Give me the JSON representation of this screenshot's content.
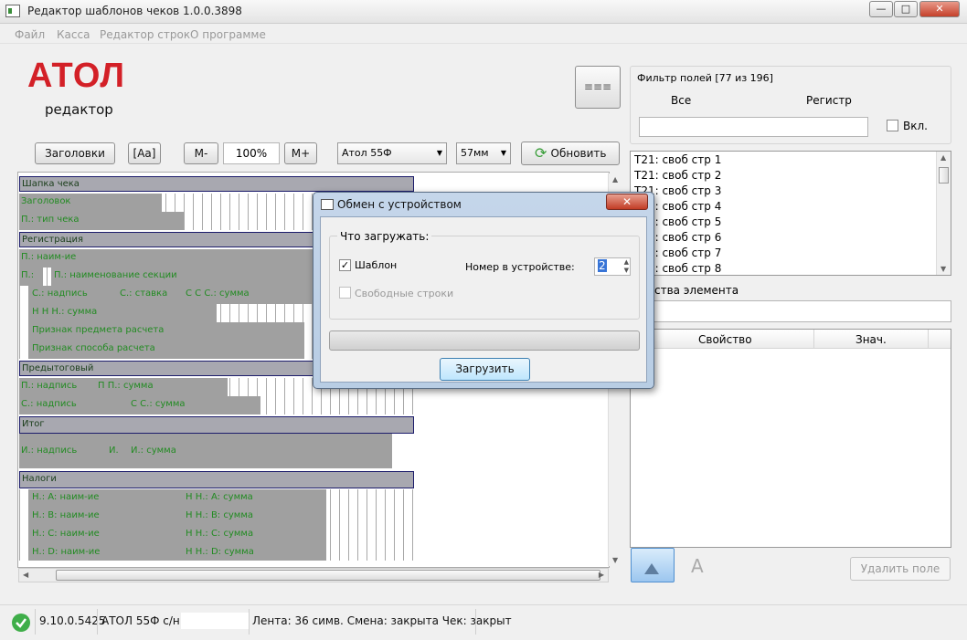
{
  "window": {
    "title": "Редактор шаблонов чеков 1.0.0.3898",
    "minimize": "—",
    "restore": "□",
    "close": "✕"
  },
  "menu": [
    "Файл",
    "Касса",
    "Редактор строк",
    "О программе"
  ],
  "logo": {
    "brand": "АТОЛ",
    "subtitle": "редактор"
  },
  "toolbar": {
    "headers_btn": "Заголовки",
    "font_btn": "[Aa]",
    "zoom_out": "M-",
    "zoom_value": "100%",
    "zoom_in": "M+",
    "device": "Атол 55Ф",
    "width": "57мм",
    "refresh": "Обновить",
    "menu_btn": "≡≡≡"
  },
  "editor": {
    "sections": [
      {
        "title": "Шапка чека"
      },
      {
        "title": "Регистрация"
      },
      {
        "title": "Предытоговый"
      },
      {
        "title": "Итог"
      },
      {
        "title": "Налоги"
      }
    ],
    "rows": {
      "r1": [
        "Заголовок"
      ],
      "r2": [
        "П.: тип чека"
      ],
      "r3": [
        "П.: наим-ие"
      ],
      "r4": [
        "П.:",
        "П.: наименование секции"
      ],
      "r5": [
        "С.: надпись",
        "С.: ставка",
        "С С С.: сумма"
      ],
      "r6": [
        "Н Н Н.: сумма"
      ],
      "r7": [
        "Признак предмета расчета"
      ],
      "r8": [
        "Признак способа расчета"
      ],
      "r9": [
        "П.: надпись",
        "П П.: сумма"
      ],
      "r10": [
        "С.: надпись",
        "С С.: сумма"
      ],
      "r11": [
        "И.: надпись",
        "И.",
        "И.: сумма"
      ],
      "t1": [
        "Н.: A: наим-ие",
        "Н Н.: A: сумма"
      ],
      "t2": [
        "Н.: B: наим-ие",
        "Н Н.: B: сумма"
      ],
      "t3": [
        "Н.: C: наим-ие",
        "Н Н.: C: сумма"
      ],
      "t4": [
        "Н.: D: наим-ие",
        "Н Н.: D: сумма"
      ]
    }
  },
  "filter": {
    "title": "Фильтр полей [77 из 196]",
    "col_all": "Все",
    "col_register": "Регистр",
    "enable_label": "Вкл.",
    "items": [
      "T21: своб стр 1",
      "T21: своб стр 2",
      "T21: своб стр 3",
      "T21: своб стр 4",
      "T21: своб стр 5",
      "T21: своб стр 6",
      "T21: своб стр 7",
      "T21: своб стр 8"
    ]
  },
  "properties": {
    "title": "ства элемента",
    "col_property": "Свойство",
    "col_value": "Знач.",
    "delete_btn": "Удалить поле",
    "text_icon": "A"
  },
  "dialog": {
    "title": "Обмен с устройством",
    "group_label": "Что загружать:",
    "template_label": "Шаблон",
    "template_checked": true,
    "free_lines_label": "Свободные строки",
    "free_lines_checked": false,
    "number_label": "Номер в устройстве:",
    "number_value": "2",
    "load_btn": "Загрузить",
    "close": "✕",
    "progress": 0
  },
  "status": {
    "version": "9.10.0.5425",
    "device": "АТОЛ 55Ф с/н:0",
    "info": "Лента: 36 симв. Смена: закрыта Чек: закрыт"
  },
  "colors": {
    "accent": "#d32027",
    "ok": "#3fae49"
  }
}
